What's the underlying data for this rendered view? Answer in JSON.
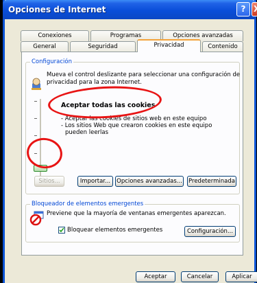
{
  "window": {
    "title": "Opciones de Internet",
    "help_glyph": "?",
    "close_glyph": "X"
  },
  "tabs": {
    "row1": [
      "Conexiones",
      "Programas",
      "Opciones avanzadas"
    ],
    "row2": [
      "General",
      "Seguridad",
      "Privacidad",
      "Contenido"
    ],
    "active": "Privacidad"
  },
  "config": {
    "label": "Configuración",
    "desc_line1": "Mueva el control deslizante para seleccionar una configuración de",
    "desc_line2": "privacidad para la zona Internet.",
    "level_title": "Aceptar todas las cookies",
    "bullet1": "- Aceptar las cookies de sitios web en este equipo",
    "bullet2": "- Los sitios Web que crearon cookies en este equipo",
    "bullet2b": "pueden leerlas",
    "slider_level": "lowest",
    "buttons": {
      "sitios": "Sitios...",
      "importar": "Importar...",
      "avanzadas": "Opciones avanzadas...",
      "predeterminada": "Predeterminada"
    }
  },
  "popup": {
    "label": "Bloqueador de elementos emergentes",
    "desc": "Previene que la mayoría de ventanas emergentes aparezcan.",
    "checkbox_label": "Bloquear elementos emergentes",
    "checkbox_checked": true,
    "config_button": "Configuración..."
  },
  "footer": {
    "accept": "Aceptar",
    "cancel": "Cancelar",
    "apply": "Aplicar"
  },
  "colors": {
    "title_bar": "#0a4ed9",
    "annotation": "#e81414",
    "group_label": "#0046d5"
  }
}
